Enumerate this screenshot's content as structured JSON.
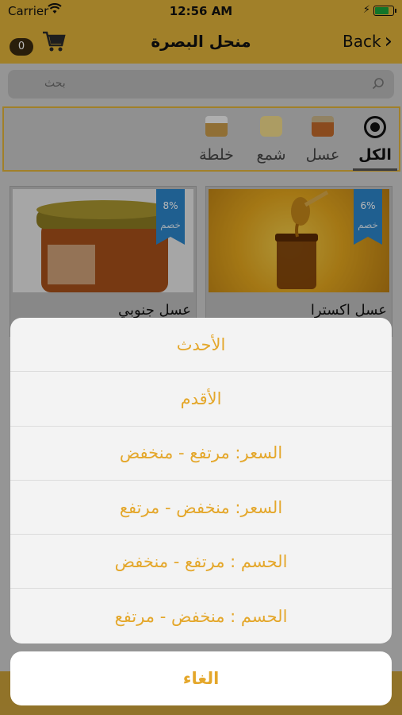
{
  "status_bar": {
    "carrier": "Carrier",
    "time": "12:56 AM"
  },
  "nav": {
    "title": "منحل البصرة",
    "back_label": "Back",
    "cart_count": "0"
  },
  "search": {
    "placeholder": "بحث"
  },
  "categories": [
    {
      "label": "الكل",
      "active": true
    },
    {
      "label": "عسل",
      "active": false
    },
    {
      "label": "شمع",
      "active": false
    },
    {
      "label": "خلطة",
      "active": false
    }
  ],
  "products": [
    {
      "name": "عسل اكسترا",
      "discount": "6%",
      "badge": "خصم"
    },
    {
      "name": "عسل جنوبي",
      "discount": "8%",
      "badge": "خصم"
    }
  ],
  "sort_sheet": {
    "options": [
      "الأحدث",
      "الأقدم",
      "السعر: مرتفع - منخفض",
      "السعر: منخفض - مرتفع",
      "الحسم : مرتفع - منخفض",
      "الحسم : منخفض - مرتفع"
    ],
    "cancel_label": "الغاء"
  },
  "colors": {
    "brand_gold": "#e0b23a",
    "sheet_text": "#e4a72b",
    "ribbon_blue": "#2b84c8"
  }
}
